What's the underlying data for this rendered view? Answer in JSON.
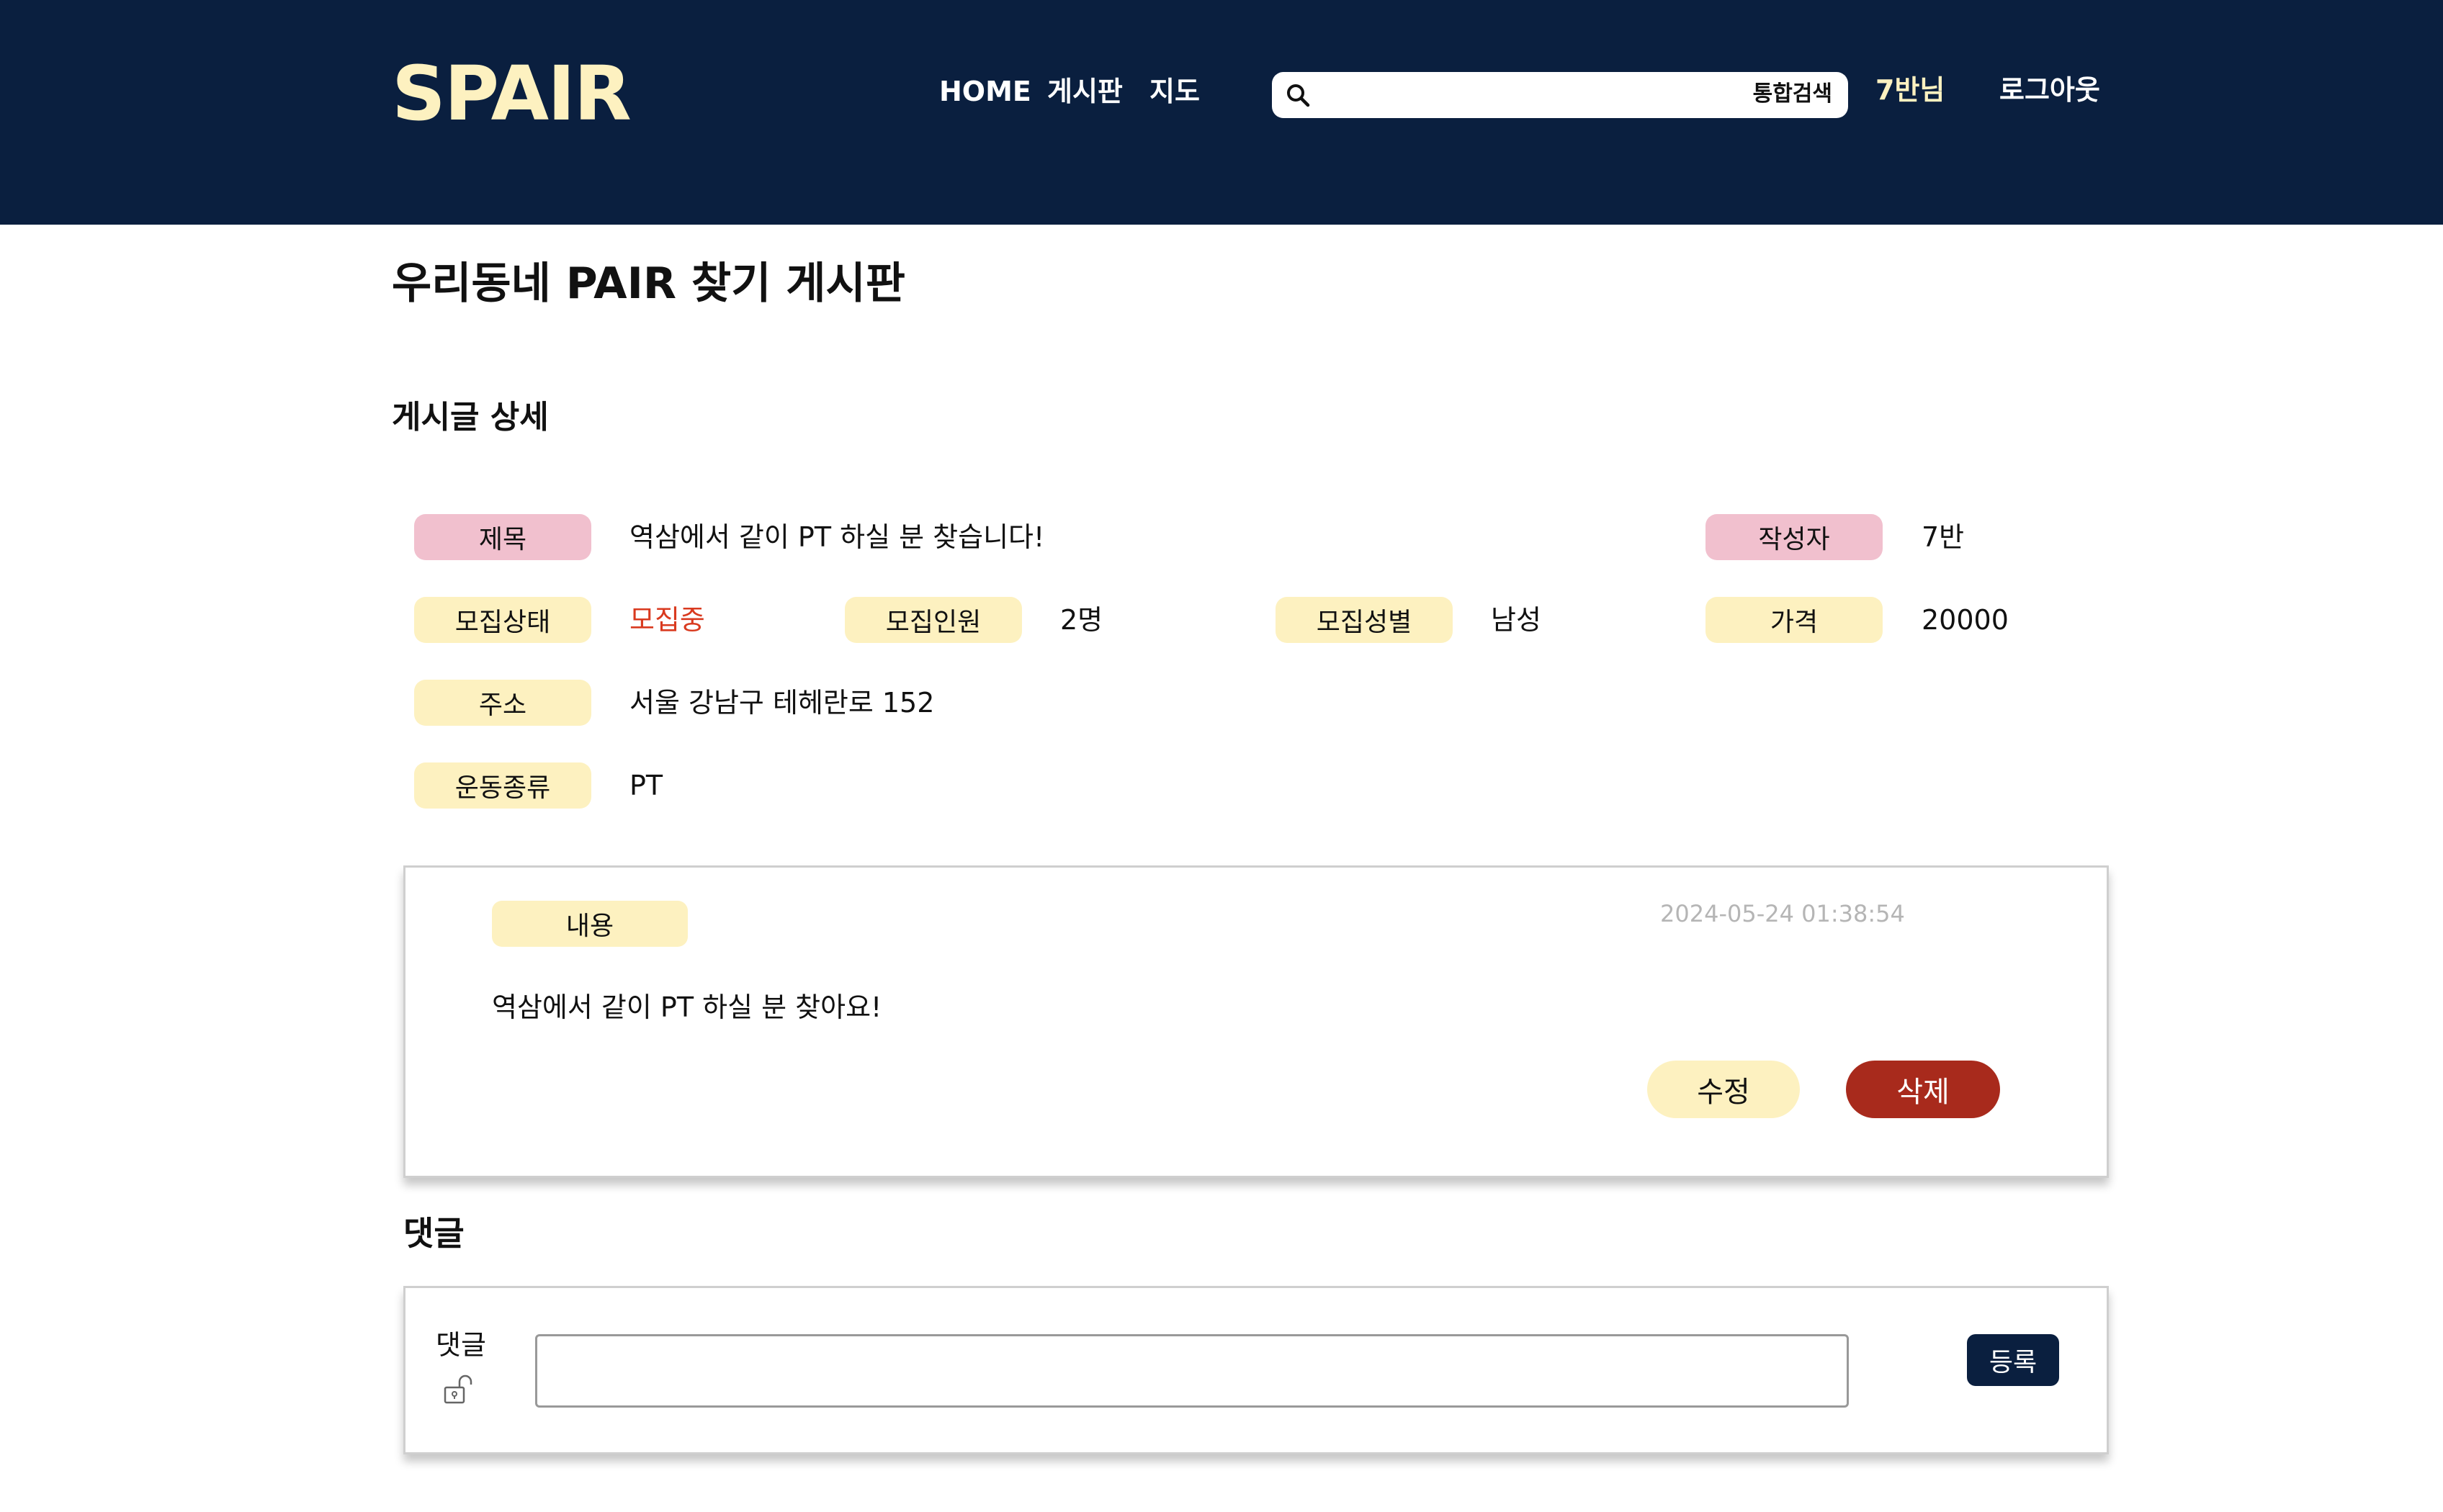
{
  "header": {
    "logo": "SPAIR",
    "nav": {
      "home": "HOME",
      "board": "게시판",
      "map": "지도"
    },
    "search": {
      "placeholder": "",
      "button_label": "통합검색"
    },
    "user": "7반님",
    "logout": "로그아웃"
  },
  "page": {
    "title": "우리동네 PAIR 찾기 게시판",
    "section_title": "게시글 상세"
  },
  "post": {
    "labels": {
      "title": "제목",
      "author": "작성자",
      "status": "모집상태",
      "headcount": "모집인원",
      "gender": "모집성별",
      "price": "가격",
      "address": "주소",
      "exercise": "운동종류",
      "content": "내용"
    },
    "title": "역삼에서 같이 PT 하실 분 찾습니다!",
    "author": "7반",
    "status": "모집중",
    "headcount": "2명",
    "gender": "남성",
    "price": "20000",
    "address": "서울 강남구 테헤란로 152",
    "exercise": "PT",
    "created_at": "2024-05-24 01:38:54",
    "content": "역삼에서 같이 PT 하실 분 찾아요!",
    "edit_label": "수정",
    "delete_label": "삭제"
  },
  "comments": {
    "title": "댓글",
    "label": "댓글",
    "input_value": "",
    "submit_label": "등록"
  },
  "colors": {
    "header_bg": "#0a1f3f",
    "accent_yellow": "#fdf1c0",
    "accent_pink": "#f1c0ce",
    "status_red": "#d93a1f",
    "delete_red": "#a82a1c"
  }
}
